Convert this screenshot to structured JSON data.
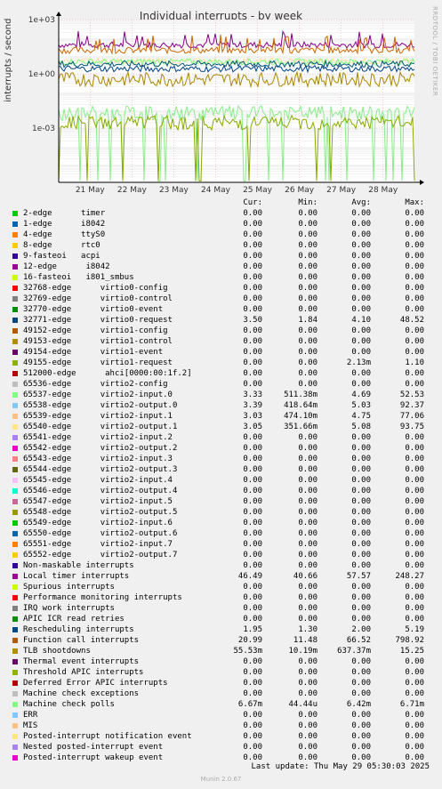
{
  "chart_data": {
    "type": "line",
    "title": "Individual interrupts - by week",
    "ylabel": "interrupts / second",
    "yscale": "log",
    "ylim": [
      1e-06,
      1000
    ],
    "yticks": [
      "1e+03",
      "1e+00",
      "1e-03"
    ],
    "x_ticks": [
      "21 May",
      "22 May",
      "23 May",
      "24 May",
      "25 May",
      "26 May",
      "27 May",
      "28 May"
    ],
    "grid": true,
    "series_levels": [
      {
        "name": "Local timer interrupts",
        "color": "#880088",
        "level": 40
      },
      {
        "name": "Function call interrupts",
        "color": "#cc6600",
        "level": 20
      },
      {
        "name": "65540-edge virtio2-output.1",
        "color": "#ffe0a0",
        "level": 5
      },
      {
        "name": "65537-edge virtio2-input.0",
        "color": "#80ff80",
        "level": 4.7
      },
      {
        "name": "32771-edge virtio0-request",
        "color": "#005577",
        "level": 3.5
      },
      {
        "name": "Rescheduling interrupts",
        "color": "#004488",
        "level": 1.9
      },
      {
        "name": "TLB shootdowns",
        "color": "#aa8800",
        "level": 0.5
      },
      {
        "name": "Machine check polls",
        "color": "#88ee88",
        "level": 0.0067
      },
      {
        "name": "49155-edge virtio1-request",
        "color": "#88aa00",
        "level": 0.002
      }
    ]
  },
  "watermark": "RRDTOOL / TOBI OETIKER",
  "legend_header": {
    "cur": "Cur:",
    "min": "Min:",
    "avg": "Avg:",
    "max": "Max:"
  },
  "legend": [
    {
      "label": "2-edge      timer",
      "color": "#00cc00",
      "cur": "0.00",
      "min": "0.00",
      "avg": "0.00",
      "max": "0.00"
    },
    {
      "label": "1-edge      i8042",
      "color": "#0066b3",
      "cur": "0.00",
      "min": "0.00",
      "avg": "0.00",
      "max": "0.00"
    },
    {
      "label": "4-edge      ttyS0",
      "color": "#ff8000",
      "cur": "0.00",
      "min": "0.00",
      "avg": "0.00",
      "max": "0.00"
    },
    {
      "label": "8-edge      rtc0",
      "color": "#ffcc00",
      "cur": "0.00",
      "min": "0.00",
      "avg": "0.00",
      "max": "0.00"
    },
    {
      "label": "9-fasteoi   acpi",
      "color": "#330099",
      "cur": "0.00",
      "min": "0.00",
      "avg": "0.00",
      "max": "0.00"
    },
    {
      "label": "12-edge      i8042",
      "color": "#990099",
      "cur": "0.00",
      "min": "0.00",
      "avg": "0.00",
      "max": "0.00"
    },
    {
      "label": "16-fasteoi   i801_smbus",
      "color": "#ccff00",
      "cur": "0.00",
      "min": "0.00",
      "avg": "0.00",
      "max": "0.00"
    },
    {
      "label": "32768-edge      virtio0-config",
      "color": "#ff0000",
      "cur": "0.00",
      "min": "0.00",
      "avg": "0.00",
      "max": "0.00"
    },
    {
      "label": "32769-edge      virtio0-control",
      "color": "#808080",
      "cur": "0.00",
      "min": "0.00",
      "avg": "0.00",
      "max": "0.00"
    },
    {
      "label": "32770-edge      virtio0-event",
      "color": "#008f00",
      "cur": "0.00",
      "min": "0.00",
      "avg": "0.00",
      "max": "0.00"
    },
    {
      "label": "32771-edge      virtio0-request",
      "color": "#00487d",
      "cur": "3.50",
      "min": "1.84",
      "avg": "4.10",
      "max": "48.52"
    },
    {
      "label": "49152-edge      virtio1-config",
      "color": "#b35a00",
      "cur": "0.00",
      "min": "0.00",
      "avg": "0.00",
      "max": "0.00"
    },
    {
      "label": "49153-edge      virtio1-control",
      "color": "#b38f00",
      "cur": "0.00",
      "min": "0.00",
      "avg": "0.00",
      "max": "0.00"
    },
    {
      "label": "49154-edge      virtio1-event",
      "color": "#6b006b",
      "cur": "0.00",
      "min": "0.00",
      "avg": "0.00",
      "max": "0.00"
    },
    {
      "label": "49155-edge      virtio1-request",
      "color": "#8fb300",
      "cur": "0.00",
      "min": "0.00",
      "avg": "2.13m",
      "max": "1.10"
    },
    {
      "label": "512000-edge      ahci[0000:00:1f.2]",
      "color": "#b30000",
      "cur": "0.00",
      "min": "0.00",
      "avg": "0.00",
      "max": "0.00"
    },
    {
      "label": "65536-edge      virtio2-config",
      "color": "#bebebe",
      "cur": "0.00",
      "min": "0.00",
      "avg": "0.00",
      "max": "0.00"
    },
    {
      "label": "65537-edge      virtio2-input.0",
      "color": "#80ff80",
      "cur": "3.33",
      "min": "511.38m",
      "avg": "4.69",
      "max": "52.53"
    },
    {
      "label": "65538-edge      virtio2-output.0",
      "color": "#80c9ff",
      "cur": "3.39",
      "min": "418.64m",
      "avg": "5.03",
      "max": "92.37"
    },
    {
      "label": "65539-edge      virtio2-input.1",
      "color": "#ffc080",
      "cur": "3.03",
      "min": "474.10m",
      "avg": "4.75",
      "max": "77.06"
    },
    {
      "label": "65540-edge      virtio2-output.1",
      "color": "#ffe680",
      "cur": "3.05",
      "min": "351.66m",
      "avg": "5.08",
      "max": "93.75"
    },
    {
      "label": "65541-edge      virtio2-input.2",
      "color": "#aa80ff",
      "cur": "0.00",
      "min": "0.00",
      "avg": "0.00",
      "max": "0.00"
    },
    {
      "label": "65542-edge      virtio2-output.2",
      "color": "#ee00cc",
      "cur": "0.00",
      "min": "0.00",
      "avg": "0.00",
      "max": "0.00"
    },
    {
      "label": "65543-edge      virtio2-input.3",
      "color": "#ff8080",
      "cur": "0.00",
      "min": "0.00",
      "avg": "0.00",
      "max": "0.00"
    },
    {
      "label": "65544-edge      virtio2-output.3",
      "color": "#666600",
      "cur": "0.00",
      "min": "0.00",
      "avg": "0.00",
      "max": "0.00"
    },
    {
      "label": "65545-edge      virtio2-input.4",
      "color": "#ffbfff",
      "cur": "0.00",
      "min": "0.00",
      "avg": "0.00",
      "max": "0.00"
    },
    {
      "label": "65546-edge      virtio2-output.4",
      "color": "#00ffcc",
      "cur": "0.00",
      "min": "0.00",
      "avg": "0.00",
      "max": "0.00"
    },
    {
      "label": "65547-edge      virtio2-input.5",
      "color": "#cc6699",
      "cur": "0.00",
      "min": "0.00",
      "avg": "0.00",
      "max": "0.00"
    },
    {
      "label": "65548-edge      virtio2-output.5",
      "color": "#999900",
      "cur": "0.00",
      "min": "0.00",
      "avg": "0.00",
      "max": "0.00"
    },
    {
      "label": "65549-edge      virtio2-input.6",
      "color": "#00cc00",
      "cur": "0.00",
      "min": "0.00",
      "avg": "0.00",
      "max": "0.00"
    },
    {
      "label": "65550-edge      virtio2-output.6",
      "color": "#0066b3",
      "cur": "0.00",
      "min": "0.00",
      "avg": "0.00",
      "max": "0.00"
    },
    {
      "label": "65551-edge      virtio2-input.7",
      "color": "#ff8000",
      "cur": "0.00",
      "min": "0.00",
      "avg": "0.00",
      "max": "0.00"
    },
    {
      "label": "65552-edge      virtio2-output.7",
      "color": "#ffcc00",
      "cur": "0.00",
      "min": "0.00",
      "avg": "0.00",
      "max": "0.00"
    },
    {
      "label": "Non-maskable interrupts",
      "color": "#330099",
      "cur": "0.00",
      "min": "0.00",
      "avg": "0.00",
      "max": "0.00"
    },
    {
      "label": "Local timer interrupts",
      "color": "#990099",
      "cur": "46.49",
      "min": "40.66",
      "avg": "57.57",
      "max": "248.27"
    },
    {
      "label": "Spurious interrupts",
      "color": "#ccff00",
      "cur": "0.00",
      "min": "0.00",
      "avg": "0.00",
      "max": "0.00"
    },
    {
      "label": "Performance monitoring interrupts",
      "color": "#ff0000",
      "cur": "0.00",
      "min": "0.00",
      "avg": "0.00",
      "max": "0.00"
    },
    {
      "label": "IRQ work interrupts",
      "color": "#808080",
      "cur": "0.00",
      "min": "0.00",
      "avg": "0.00",
      "max": "0.00"
    },
    {
      "label": "APIC ICR read retries",
      "color": "#008f00",
      "cur": "0.00",
      "min": "0.00",
      "avg": "0.00",
      "max": "0.00"
    },
    {
      "label": "Rescheduling interrupts",
      "color": "#00487d",
      "cur": "1.95",
      "min": "1.30",
      "avg": "2.00",
      "max": "5.19"
    },
    {
      "label": "Function call interrupts",
      "color": "#b35a00",
      "cur": "20.99",
      "min": "11.48",
      "avg": "66.52",
      "max": "798.92"
    },
    {
      "label": "TLB shootdowns",
      "color": "#b38f00",
      "cur": "55.53m",
      "min": "10.19m",
      "avg": "637.37m",
      "max": "15.25"
    },
    {
      "label": "Thermal event interrupts",
      "color": "#6b006b",
      "cur": "0.00",
      "min": "0.00",
      "avg": "0.00",
      "max": "0.00"
    },
    {
      "label": "Threshold APIC interrupts",
      "color": "#8fb300",
      "cur": "0.00",
      "min": "0.00",
      "avg": "0.00",
      "max": "0.00"
    },
    {
      "label": "Deferred Error APIC interrupts",
      "color": "#b30000",
      "cur": "0.00",
      "min": "0.00",
      "avg": "0.00",
      "max": "0.00"
    },
    {
      "label": "Machine check exceptions",
      "color": "#bebebe",
      "cur": "0.00",
      "min": "0.00",
      "avg": "0.00",
      "max": "0.00"
    },
    {
      "label": "Machine check polls",
      "color": "#80ff80",
      "cur": "6.67m",
      "min": "44.44u",
      "avg": "6.42m",
      "max": "6.71m"
    },
    {
      "label": "ERR",
      "color": "#80c9ff",
      "cur": "0.00",
      "min": "0.00",
      "avg": "0.00",
      "max": "0.00"
    },
    {
      "label": "MIS",
      "color": "#ffc080",
      "cur": "0.00",
      "min": "0.00",
      "avg": "0.00",
      "max": "0.00"
    },
    {
      "label": "Posted-interrupt notification event",
      "color": "#ffe680",
      "cur": "0.00",
      "min": "0.00",
      "avg": "0.00",
      "max": "0.00"
    },
    {
      "label": "Nested posted-interrupt event",
      "color": "#aa80ff",
      "cur": "0.00",
      "min": "0.00",
      "avg": "0.00",
      "max": "0.00"
    },
    {
      "label": "Posted-interrupt wakeup event",
      "color": "#ee00cc",
      "cur": "0.00",
      "min": "0.00",
      "avg": "0.00",
      "max": "0.00"
    }
  ],
  "last_update": "Last update: Thu May 29 05:30:03 2025",
  "footer": "Munin 2.0.67"
}
